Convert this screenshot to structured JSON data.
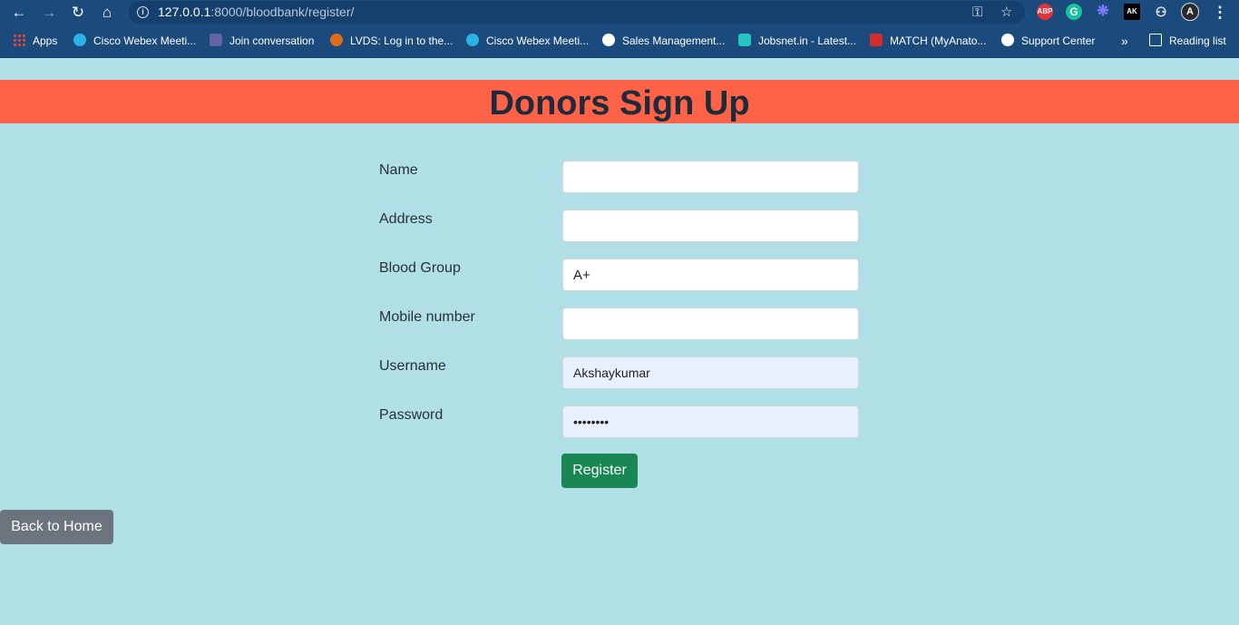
{
  "browser": {
    "url_host": "127.0.0.1",
    "url_rest": ":8000/bloodbank/register/",
    "bookmarks": [
      {
        "label": "Apps"
      },
      {
        "label": "Cisco Webex Meeti..."
      },
      {
        "label": "Join conversation"
      },
      {
        "label": "LVDS: Log in to the..."
      },
      {
        "label": "Cisco Webex Meeti..."
      },
      {
        "label": "Sales Management..."
      },
      {
        "label": "Jobsnet.in - Latest..."
      },
      {
        "label": "MATCH (MyAnato..."
      },
      {
        "label": "Support Center"
      }
    ],
    "overflow": "»",
    "reading_list": "Reading list",
    "extensions": {
      "abp": "ABP",
      "ak": "AK"
    }
  },
  "page": {
    "title": "Donors Sign Up",
    "header_color": "#ff6347",
    "background": "#b0dfe5"
  },
  "form": {
    "fields": [
      {
        "label": "Name",
        "value": ""
      },
      {
        "label": "Address",
        "value": ""
      },
      {
        "label": "Blood Group",
        "value": "A+"
      },
      {
        "label": "Mobile number",
        "value": ""
      },
      {
        "label": "Username",
        "value": "Akshaykumar"
      },
      {
        "label": "Password",
        "value": "••••••••"
      }
    ],
    "register_label": "Register",
    "register_color": "#198754"
  },
  "back_home_label": "Back to Home"
}
